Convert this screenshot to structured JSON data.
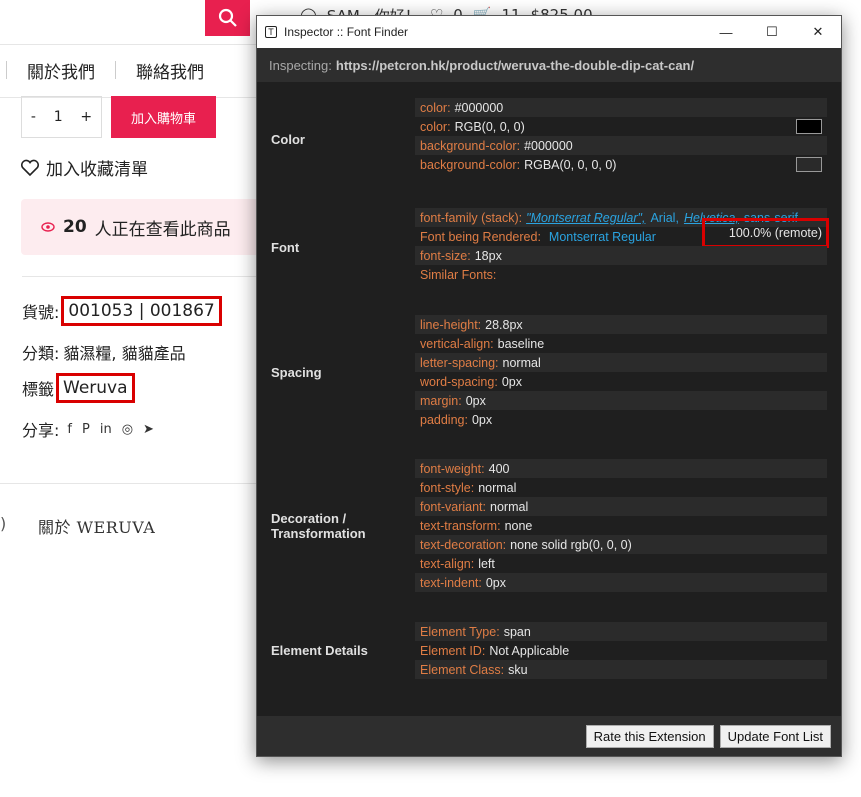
{
  "page": {
    "topbar": {
      "user": "SAM，你好！",
      "wish_count": "0",
      "cart_count": "11",
      "cart_total": "$825.00"
    },
    "nav": [
      "關於我們",
      "聯絡我們"
    ],
    "qty": {
      "minus": "-",
      "value": "1",
      "plus": "+"
    },
    "add_to_cart": "加入購物車",
    "wishlist": "加入收藏清單",
    "viewing": {
      "count": "20",
      "text": "人正在查看此商品"
    },
    "sku_label": "貨號:",
    "sku_value": "001053 | 001867",
    "category_label": "分類:",
    "category_value": "貓濕糧, 貓貓產品",
    "tag_label": "標籤",
    "tag_value": "Weruva",
    "share_label": "分享:",
    "share_icons": [
      "f",
      "P",
      "in",
      "◎",
      "➤"
    ],
    "footer_paren": ")",
    "footer_link": "關於 WERUVA"
  },
  "inspector": {
    "title": "Inspector :: Font Finder",
    "inspecting_label": "Inspecting:",
    "inspecting_url": "https://petcron.hk/product/weruva-the-double-dip-cat-can/",
    "sections": {
      "color": {
        "label": "Color",
        "rows": [
          {
            "k": "color:",
            "v": "#000000"
          },
          {
            "k": "color:",
            "v": "RGB(0, 0, 0)",
            "swatch": "#000000"
          },
          {
            "k": "background-color:",
            "v": "#000000"
          },
          {
            "k": "background-color:",
            "v": "RGBA(0, 0, 0, 0)",
            "swatch": "#2a2a2a"
          }
        ]
      },
      "font": {
        "label": "Font",
        "family_key": "font-family (stack):",
        "family_values": [
          "\"Montserrat Regular\",",
          "Arial,",
          "Helvetica,",
          "sans-serif"
        ],
        "rendered_key": "Font being Rendered:",
        "rendered_value": "Montserrat Regular",
        "rendered_pct": "100.0% (remote)",
        "size_key": "font-size:",
        "size_value": "18px",
        "similar_key": "Similar Fonts:"
      },
      "spacing": {
        "label": "Spacing",
        "rows": [
          {
            "k": "line-height:",
            "v": "28.8px"
          },
          {
            "k": "vertical-align:",
            "v": "baseline"
          },
          {
            "k": "letter-spacing:",
            "v": "normal"
          },
          {
            "k": "word-spacing:",
            "v": "0px"
          },
          {
            "k": "margin:",
            "v": "0px"
          },
          {
            "k": "padding:",
            "v": "0px"
          }
        ]
      },
      "decoration": {
        "label_line1": "Decoration /",
        "label_line2": "Transformation",
        "rows": [
          {
            "k": "font-weight:",
            "v": "400"
          },
          {
            "k": "font-style:",
            "v": "normal"
          },
          {
            "k": "font-variant:",
            "v": "normal"
          },
          {
            "k": "text-transform:",
            "v": "none"
          },
          {
            "k": "text-decoration:",
            "v": "none solid rgb(0, 0, 0)"
          },
          {
            "k": "text-align:",
            "v": "left"
          },
          {
            "k": "text-indent:",
            "v": "0px"
          }
        ]
      },
      "element": {
        "label": "Element Details",
        "rows": [
          {
            "k": "Element Type:",
            "v": "span"
          },
          {
            "k": "Element ID:",
            "v": "Not Applicable"
          },
          {
            "k": "Element Class:",
            "v": "sku"
          }
        ]
      }
    },
    "buttons": {
      "rate": "Rate this Extension",
      "update": "Update Font List"
    }
  }
}
